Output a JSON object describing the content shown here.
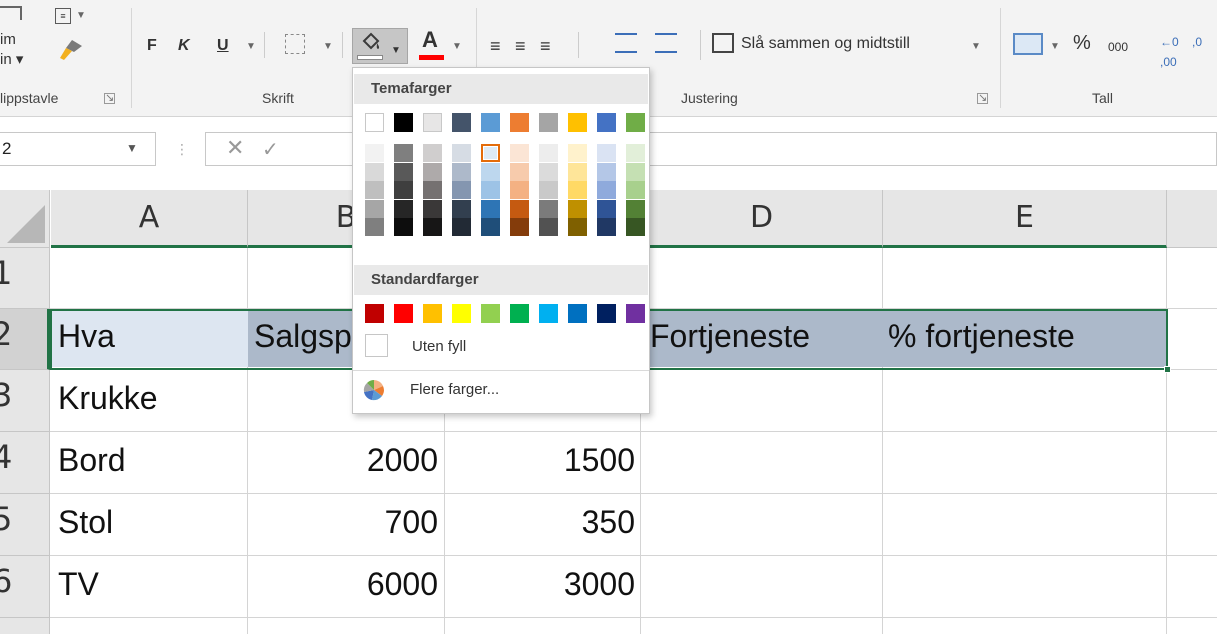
{
  "ribbon": {
    "clipboard": {
      "group_label": "lippstavle",
      "paste_lines": [
        "im",
        "in ▾"
      ]
    },
    "font": {
      "group_label": "Skrift",
      "bold": "F",
      "italic": "K",
      "underline": "U",
      "font_color_letter": "A"
    },
    "alignment": {
      "group_label": "Justering",
      "merge_label": "Slå sammen og midtstill"
    },
    "number": {
      "group_label": "Tall",
      "percent": "%",
      "thousands": "000"
    },
    "colors": {
      "font_color_bar": "#ff0000",
      "fill_bar": "#ffffff",
      "accent": "#217346"
    }
  },
  "formula_bar": {
    "name_box": "2",
    "cancel_icon": "✕",
    "enter_icon": "✓"
  },
  "sheet": {
    "columns": [
      "A",
      "B",
      "C",
      "D",
      "E"
    ],
    "rows": [
      "1",
      "2",
      "3",
      "4",
      "5",
      "6"
    ],
    "cells": [
      {
        "ref": "A2",
        "text": "Hva"
      },
      {
        "ref": "B2",
        "text": "Salgsp"
      },
      {
        "ref": "D2",
        "text": "Fortjeneste"
      },
      {
        "ref": "E2",
        "text": "% fortjeneste"
      },
      {
        "ref": "A3",
        "text": "Krukke"
      },
      {
        "ref": "A4",
        "text": "Bord"
      },
      {
        "ref": "B4",
        "text": "2000"
      },
      {
        "ref": "C4",
        "text": "1500"
      },
      {
        "ref": "A5",
        "text": "Stol"
      },
      {
        "ref": "B5",
        "text": "700"
      },
      {
        "ref": "C5",
        "text": "350"
      },
      {
        "ref": "A6",
        "text": "TV"
      },
      {
        "ref": "B6",
        "text": "6000"
      },
      {
        "ref": "C6",
        "text": "3000"
      }
    ],
    "selection_fill": "#acb9ca"
  },
  "fill_color_menu": {
    "theme_header": "Temafarger",
    "theme_colors": [
      "#ffffff",
      "#000000",
      "#e7e6e6",
      "#44546a",
      "#5b9bd5",
      "#ed7d31",
      "#a5a5a5",
      "#ffc000",
      "#4472c4",
      "#70ad47"
    ],
    "theme_shades": [
      [
        "#f2f2f2",
        "#d9d9d9",
        "#bfbfbf",
        "#a6a6a6",
        "#7f7f7f"
      ],
      [
        "#7f7f7f",
        "#595959",
        "#3f3f3f",
        "#262626",
        "#0d0d0d"
      ],
      [
        "#d0cece",
        "#aeaaaa",
        "#757171",
        "#3a3838",
        "#171616"
      ],
      [
        "#d6dce4",
        "#adb9ca",
        "#8496b0",
        "#323f4f",
        "#222a35"
      ],
      [
        "#deebf6",
        "#bdd7ee",
        "#9dc3e6",
        "#2e75b5",
        "#1f4e79"
      ],
      [
        "#fbe5d5",
        "#f7cbac",
        "#f4b183",
        "#c55a11",
        "#843c0b"
      ],
      [
        "#ededed",
        "#dbdbdb",
        "#c9c9c9",
        "#7b7b7b",
        "#525252"
      ],
      [
        "#fff2cc",
        "#fee599",
        "#ffd965",
        "#bf9000",
        "#7f6000"
      ],
      [
        "#dae3f3",
        "#b4c7e7",
        "#8faadc",
        "#2f5496",
        "#203864"
      ],
      [
        "#e2efd9",
        "#c5e0b3",
        "#a8d08d",
        "#538135",
        "#375623"
      ]
    ],
    "selected_shade": {
      "column": 4,
      "row": 0
    },
    "standard_header": "Standardfarger",
    "standard_colors": [
      "#c00000",
      "#ff0000",
      "#ffc000",
      "#ffff00",
      "#92d050",
      "#00b050",
      "#00b0f0",
      "#0070c0",
      "#002060",
      "#7030a0"
    ],
    "no_fill_label": "Uten fyll",
    "more_colors_label": "Flere farger..."
  }
}
